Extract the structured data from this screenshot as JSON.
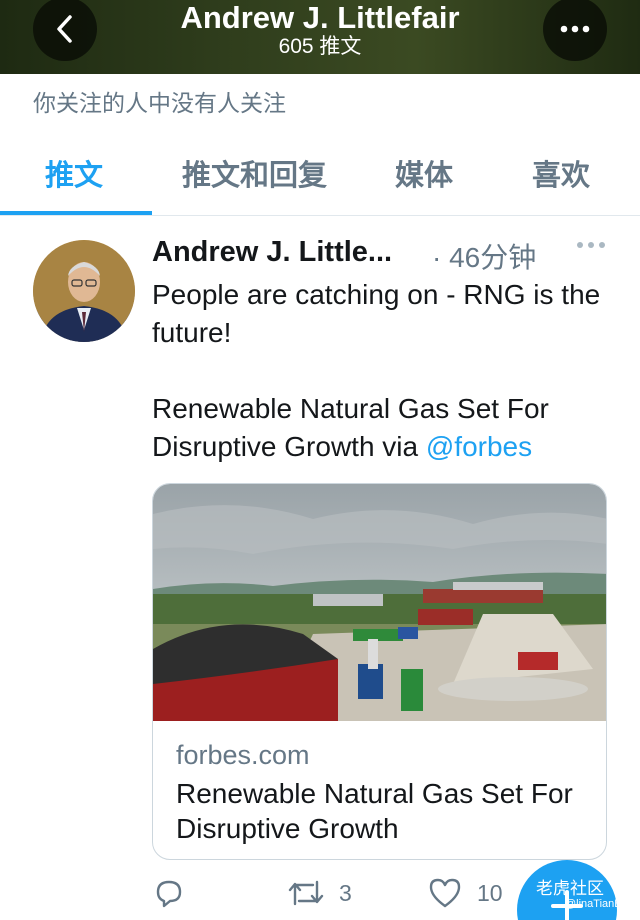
{
  "header": {
    "title": "Andrew J. Littlefair",
    "subtitle": "605 推文"
  },
  "follow_note": "你关注的人中没有人关注",
  "tabs": [
    {
      "label": "推文",
      "active": true
    },
    {
      "label": "推文和回复",
      "active": false
    },
    {
      "label": "媒体",
      "active": false
    },
    {
      "label": "喜欢",
      "active": false
    }
  ],
  "tweet": {
    "author": "Andrew J. Little...",
    "time": "· 46分钟",
    "text_line1": "People are catching on - RNG is the future!",
    "text_line2": "Renewable Natural Gas Set For Disruptive Growth via ",
    "mention": "@forbes",
    "card": {
      "domain": "forbes.com",
      "title": "Renewable Natural Gas Set For Disruptive Growth"
    },
    "actions": {
      "retweets": "3",
      "likes": "10"
    }
  },
  "watermark": {
    "line1": "老虎社区",
    "line2": "@linaTianB"
  },
  "colors": {
    "accent": "#1da1f2",
    "muted": "#657786"
  }
}
